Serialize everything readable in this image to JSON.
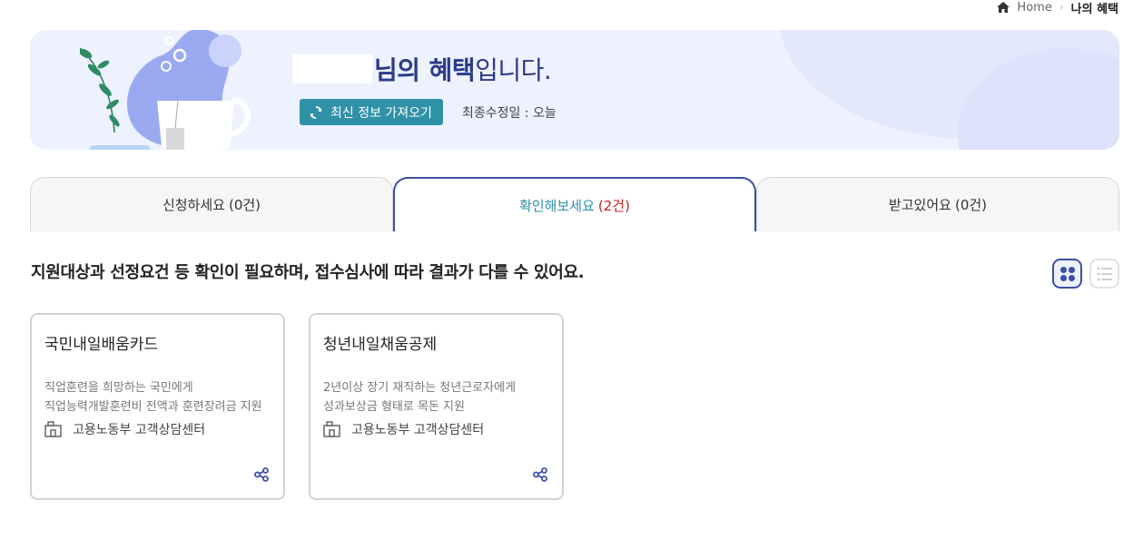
{
  "breadcrumb": {
    "home": "Home",
    "current": "나의 혜택"
  },
  "banner": {
    "greeting_suffix": "님의",
    "greeting_strong": "혜택",
    "greeting_end": "입니다.",
    "refresh_label": "최신 정보 가져오기",
    "last_updated": "최종수정일 : 오늘"
  },
  "tabs": [
    {
      "label": "신청하세요",
      "count": "(0건)"
    },
    {
      "label": "확인해보세요",
      "count": "(2건)"
    },
    {
      "label": "받고있어요",
      "count": "(0건)"
    }
  ],
  "section": {
    "description": "지원대상과 선정요건 등 확인이 필요하며, 접수심사에 따라 결과가 다를 수 있어요."
  },
  "cards": [
    {
      "title": "국민내일배움카드",
      "desc_line1": "직업훈련을 희망하는 국민에게",
      "desc_line2": "직업능력개발훈련비 전액과 훈련장려금 지원",
      "contact": "고용노동부 고객상담센터"
    },
    {
      "title": "청년내일채움공제",
      "desc_line1": "2년이상 장기 재직하는 청년근로자에게",
      "desc_line2": "성과보상금 형태로 목돈 지원",
      "contact": "고용노동부 고객상담센터"
    }
  ],
  "colors": {
    "accent": "#3b4ea8",
    "teal": "#2e91a6",
    "red": "#d01f1f",
    "banner_bg": "#eef2fe"
  }
}
